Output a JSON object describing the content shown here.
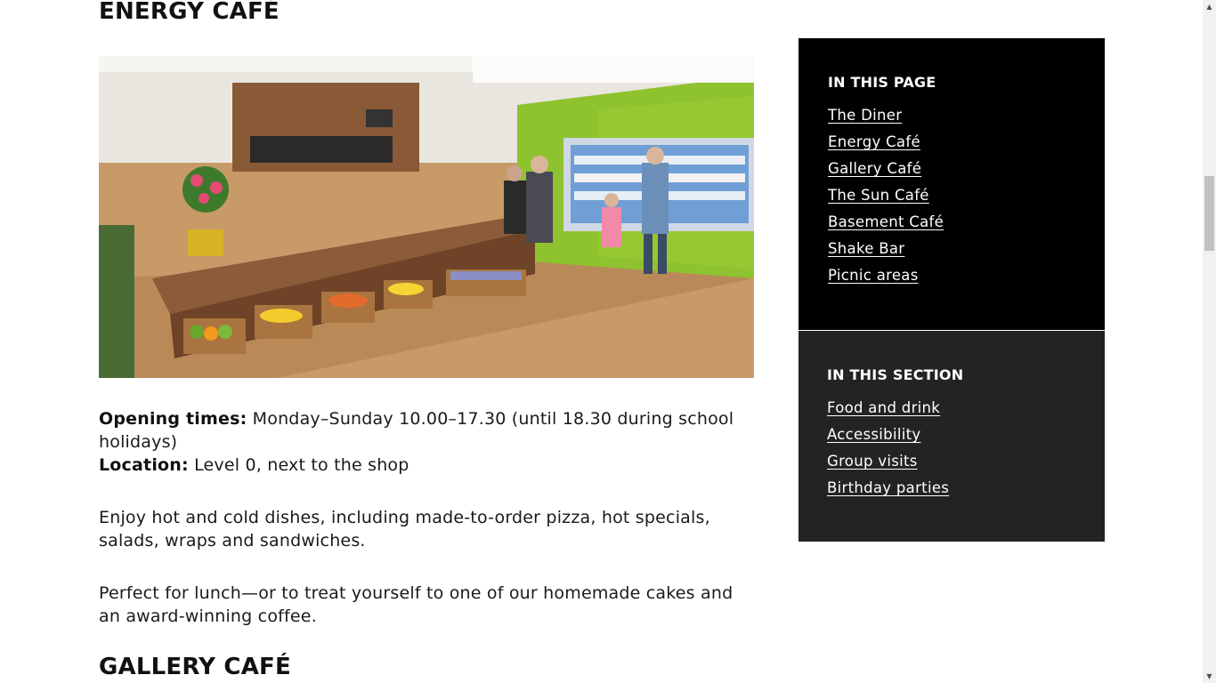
{
  "sections": {
    "energy_title": "ENERGY CAFÉ",
    "gallery_title": "GALLERY CAFÉ"
  },
  "energy": {
    "opening_label": "Opening times:",
    "opening_value": " Monday–Sunday 10.00–17.30 (until 18.30 during school holidays)",
    "location_label": "Location:",
    "location_value": " Level 0, next to the shop",
    "para1": "Enjoy hot and cold dishes, including made-to-order pizza, hot specials, salads, wraps and sandwiches.",
    "para2": "Perfect for lunch—or to treat yourself to one of our homemade cakes and an award-winning coffee."
  },
  "sidebar": {
    "page_heading": "IN THIS PAGE",
    "page_links": [
      {
        "label": "The Diner"
      },
      {
        "label": "Energy Café"
      },
      {
        "label": "Gallery Café"
      },
      {
        "label": "The Sun Café"
      },
      {
        "label": "Basement Café"
      },
      {
        "label": "Shake Bar"
      },
      {
        "label": "Picnic areas"
      }
    ],
    "section_heading": "IN THIS SECTION",
    "section_links": [
      {
        "label": "Food and drink"
      },
      {
        "label": "Accessibility"
      },
      {
        "label": "Group visits"
      },
      {
        "label": "Birthday parties"
      }
    ]
  },
  "colors": {
    "page_box_bg": "#000000",
    "section_box_bg": "#232323",
    "text": "#111111"
  },
  "scrollbar": {
    "position_fraction": 0.26
  }
}
